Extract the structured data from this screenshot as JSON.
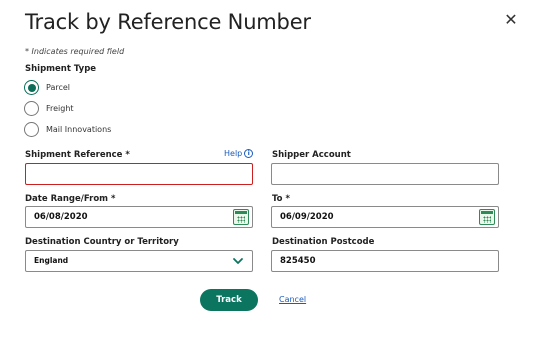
{
  "dialog": {
    "title": "Track by Reference Number",
    "close_glyph": "✕",
    "required_note": "* Indicates required field"
  },
  "shipment_type": {
    "label": "Shipment Type",
    "options": [
      {
        "label": "Parcel",
        "selected": true
      },
      {
        "label": "Freight",
        "selected": false
      },
      {
        "label": "Mail Innovations",
        "selected": false
      }
    ]
  },
  "fields": {
    "shipment_reference": {
      "label": "Shipment Reference *",
      "value": "",
      "state": "error"
    },
    "help_label": "Help",
    "help_icon_glyph": "i",
    "shipper_account": {
      "label": "Shipper Account",
      "value": ""
    },
    "date_from": {
      "label": "Date Range/From *",
      "value": "06/08/2020"
    },
    "date_to": {
      "label": "To *",
      "value": "06/09/2020"
    },
    "destination_country": {
      "label": "Destination Country or Territory",
      "value": "England"
    },
    "destination_postcode": {
      "label": "Destination Postcode",
      "value": "825450"
    }
  },
  "actions": {
    "track_label": "Track",
    "cancel_label": "Cancel"
  },
  "colors": {
    "accent": "#0b7560",
    "link": "#1a5bbf",
    "error": "#cc1f1f",
    "calendar": "#2e8b57"
  },
  "icons": {
    "close": "close-icon",
    "help": "info-icon",
    "calendar": "calendar-icon",
    "dropdown": "chevron-down-icon"
  }
}
